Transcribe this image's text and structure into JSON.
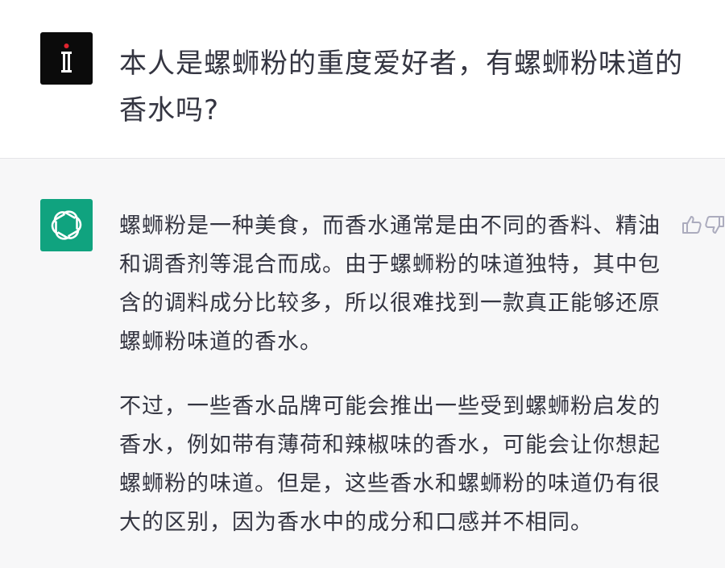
{
  "user": {
    "avatar": "user-avatar-logo",
    "message": "本人是螺蛳粉的重度爱好者，有螺蛳粉味道的香水吗?"
  },
  "assistant": {
    "avatar": "openai-logo-icon",
    "paragraphs": [
      "螺蛳粉是一种美食，而香水通常是由不同的香料、精油和调香剂等混合而成。由于螺蛳粉的味道独特，其中包含的调料成分比较多，所以很难找到一款真正能够还原螺蛳粉味道的香水。",
      "不过，一些香水品牌可能会推出一些受到螺蛳粉启发的香水，例如带有薄荷和辣椒味的香水，可能会让你想起螺蛳粉的味道。但是，这些香水和螺蛳粉的味道仍有很大的区别，因为香水中的成分和口感并不相同。"
    ],
    "feedback_icons": [
      "thumbs-up-icon",
      "thumbs-down-icon"
    ]
  },
  "colors": {
    "user_bg": "#ffffff",
    "assistant_bg": "#f7f7f8",
    "ai_avatar": "#10a37f",
    "text": "#343541",
    "icon": "#acacbe"
  }
}
